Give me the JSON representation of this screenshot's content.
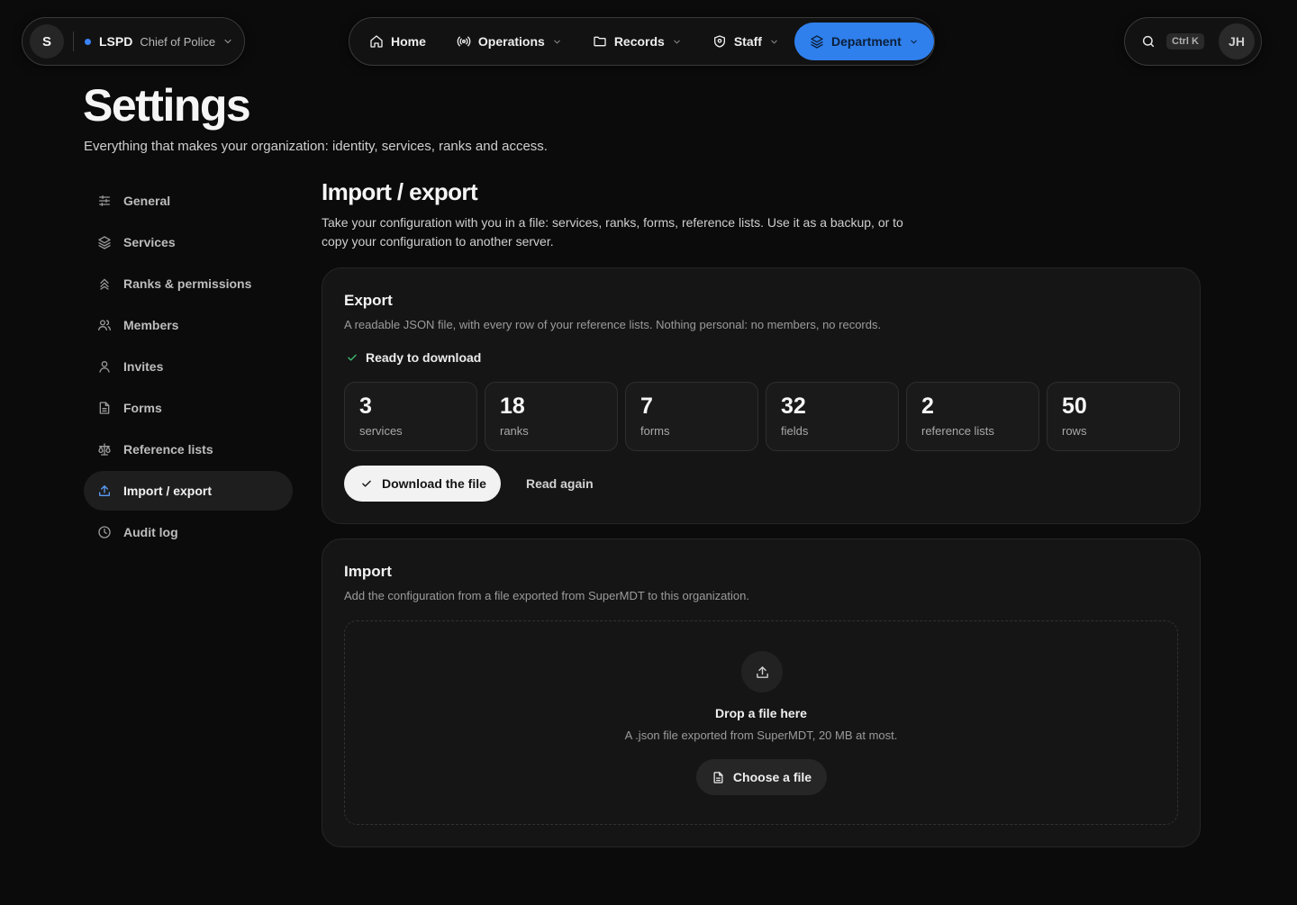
{
  "org": {
    "initial": "S",
    "name": "LSPD",
    "role": "Chief of Police",
    "status_color": "#3b82f6"
  },
  "nav": {
    "items": [
      {
        "label": "Home",
        "icon": "home-icon"
      },
      {
        "label": "Operations",
        "icon": "broadcast-icon"
      },
      {
        "label": "Records",
        "icon": "folder-icon"
      },
      {
        "label": "Staff",
        "icon": "shield-icon"
      },
      {
        "label": "Department",
        "icon": "layers-icon",
        "active": true
      }
    ],
    "accent": "#2f80ed"
  },
  "search": {
    "shortcut": "Ctrl K"
  },
  "user": {
    "initials": "JH"
  },
  "page": {
    "title": "Settings",
    "subtitle": "Everything that makes your organization: identity, services, ranks and access."
  },
  "sidebar": {
    "items": [
      {
        "label": "General",
        "icon": "sliders-icon"
      },
      {
        "label": "Services",
        "icon": "layers-icon"
      },
      {
        "label": "Ranks & permissions",
        "icon": "chevrons-up-icon"
      },
      {
        "label": "Members",
        "icon": "users-icon"
      },
      {
        "label": "Invites",
        "icon": "user-icon"
      },
      {
        "label": "Forms",
        "icon": "file-text-icon"
      },
      {
        "label": "Reference lists",
        "icon": "scale-icon"
      },
      {
        "label": "Import / export",
        "icon": "upload-icon",
        "active": true
      },
      {
        "label": "Audit log",
        "icon": "clock-icon"
      }
    ]
  },
  "section": {
    "title": "Import / export",
    "description": "Take your configuration with you in a file: services, ranks, forms, reference lists. Use it as a backup, or to copy your configuration to another server."
  },
  "export": {
    "title": "Export",
    "description": "A readable JSON file, with every row of your reference lists. Nothing personal: no members, no records.",
    "status": "Ready to download",
    "stats": [
      {
        "value": "3",
        "label": "services"
      },
      {
        "value": "18",
        "label": "ranks"
      },
      {
        "value": "7",
        "label": "forms"
      },
      {
        "value": "32",
        "label": "fields"
      },
      {
        "value": "2",
        "label": "reference lists"
      },
      {
        "value": "50",
        "label": "rows"
      }
    ],
    "download_label": "Download the file",
    "reread_label": "Read again"
  },
  "import": {
    "title": "Import",
    "description": "Add the configuration from a file exported from SuperMDT to this organization.",
    "drop_title": "Drop a file here",
    "drop_description": "A .json file exported from SuperMDT, 20 MB at most.",
    "choose_label": "Choose a file"
  }
}
